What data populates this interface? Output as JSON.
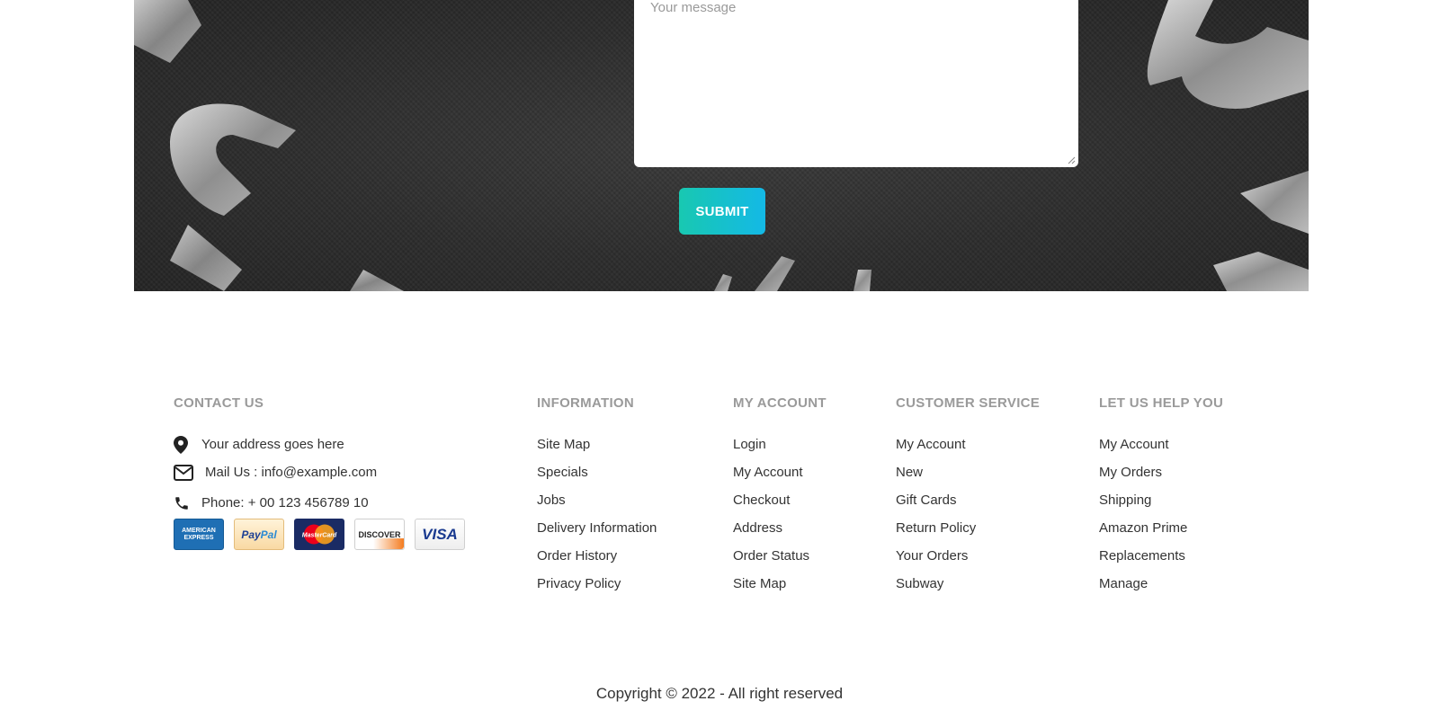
{
  "contact_form": {
    "message_placeholder": "Your message",
    "message_value": "",
    "submit_label": "SUBMIT"
  },
  "footer": {
    "contact": {
      "heading": "CONTACT US",
      "address": "Your address goes here",
      "mail": "Mail Us : info@example.com",
      "phone": "Phone: + 00 123 456789 10",
      "payment_cards": [
        {
          "icon": "american-express-card-icon",
          "label": "AMERICAN EXPRESS"
        },
        {
          "icon": "paypal-card-icon",
          "label": "PayPal"
        },
        {
          "icon": "mastercard-card-icon",
          "label": "MasterCard"
        },
        {
          "icon": "discover-card-icon",
          "label": "DISCOVER"
        },
        {
          "icon": "visa-card-icon",
          "label": "VISA"
        }
      ]
    },
    "information": {
      "heading": "INFORMATION",
      "links": [
        "Site Map",
        "Specials",
        "Jobs",
        "Delivery Information",
        "Order History",
        "Privacy Policy"
      ]
    },
    "my_account": {
      "heading": "MY ACCOUNT",
      "links": [
        "Login",
        "My Account",
        "Checkout",
        "Address",
        "Order Status",
        "Site Map"
      ]
    },
    "customer_service": {
      "heading": "CUSTOMER SERVICE",
      "links": [
        "My Account",
        "New",
        "Gift Cards",
        "Return Policy",
        "Your Orders",
        "Subway"
      ]
    },
    "help": {
      "heading": "LET US HELP YOU",
      "links": [
        "My Account",
        "My Orders",
        "Shipping",
        "Amazon Prime",
        "Replacements",
        "Manage"
      ]
    },
    "copyright": "Copyright © 2022 - All right reserved"
  },
  "colors": {
    "accent_gradient_start": "#18c8b1",
    "accent_gradient_end": "#14b9e6",
    "heading_gray": "#9a9a9a",
    "hero_background": "#2c2c2c"
  }
}
